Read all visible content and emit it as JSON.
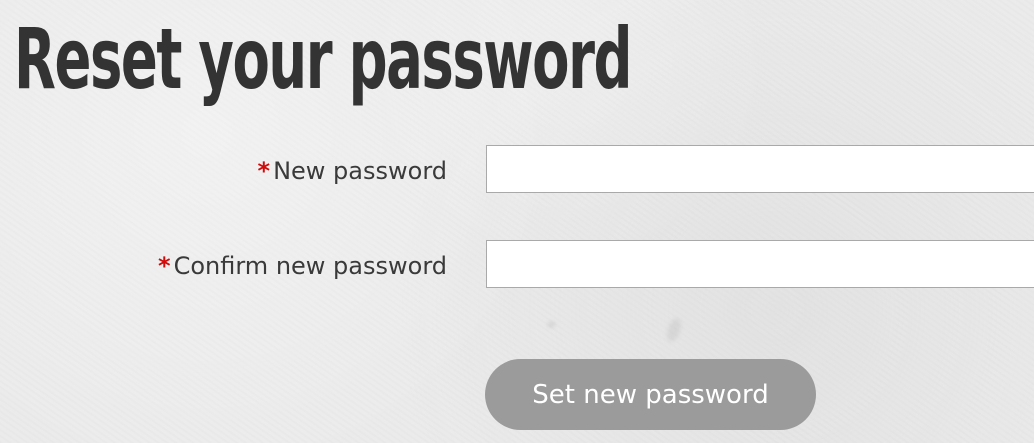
{
  "page": {
    "title": "Reset your password"
  },
  "form": {
    "required_marker": "*",
    "new_password": {
      "label": "New password",
      "value": "",
      "placeholder": ""
    },
    "confirm_password": {
      "label": "Confirm new password",
      "value": "",
      "placeholder": ""
    },
    "submit_label": "Set new password"
  },
  "colors": {
    "background": "#ebebeb",
    "title_text": "#333333",
    "required_marker": "#d10a0a",
    "button_background": "#9b9b9b",
    "button_text": "#ffffff",
    "input_border": "#a9a9a9"
  }
}
